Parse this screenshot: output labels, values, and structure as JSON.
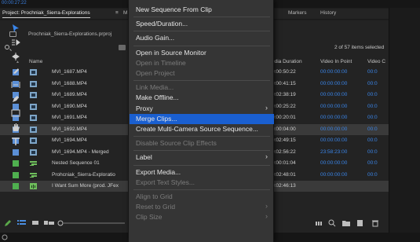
{
  "timecode": "00:00:27:22",
  "tabs": {
    "project": "Project: Prochniak_Sierra-Explorations",
    "project_menu": "≡",
    "m": "M",
    "markers": "Markers",
    "history": "History"
  },
  "project_file": "Prochniak_Sierra-Explorations.prproj",
  "selected_count": "2 of 57 items selected",
  "columns": {
    "name": "Name",
    "media_duration": "edia Duration",
    "video_in_point": "Video In Point",
    "video_c": "Video C"
  },
  "rows": [
    {
      "name": "MVI_1687.MP4",
      "duration": "0:00:50:22",
      "in": "00:00:00:00",
      "vc": "00:0",
      "swatch": "#5b8fd6",
      "icon": "clip"
    },
    {
      "name": "MVI_1688.MP4",
      "duration": "0:00:41:15",
      "in": "00:00:00:00",
      "vc": "00:0",
      "swatch": "#5b8fd6",
      "icon": "clip"
    },
    {
      "name": "MVI_1689.MP4",
      "duration": "0:02:38:19",
      "in": "00:00:00:00",
      "vc": "00:0",
      "swatch": "#5b8fd6",
      "icon": "clip"
    },
    {
      "name": "MVI_1690.MP4",
      "duration": "0:00:25:22",
      "in": "00:00:00:00",
      "vc": "00:0",
      "swatch": "#5b8fd6",
      "icon": "clip"
    },
    {
      "name": "MVI_1691.MP4",
      "duration": "0:00:20:01",
      "in": "00:00:00:00",
      "vc": "00:0",
      "swatch": "#5b8fd6",
      "icon": "clip"
    },
    {
      "name": "MVI_1692.MP4",
      "duration": "0:00:04:00",
      "in": "00:00:00:00",
      "vc": "00:0",
      "swatch": "#5b8fd6",
      "icon": "clip",
      "selected": true
    },
    {
      "name": "MVI_1694.MP4",
      "duration": "0:02:49:15",
      "in": "00:00:00:00",
      "vc": "00:0",
      "swatch": "#5b8fd6",
      "icon": "clip"
    },
    {
      "name": "MVI_1694.MP4 - Merged",
      "duration": "0:02:56:22",
      "in": "23:58:23:00",
      "vc": "00:0",
      "swatch": "#5b8fd6",
      "icon": "clip"
    },
    {
      "name": "Nested Sequence 01",
      "duration": "0:00:01:04",
      "in": "00:00:00:00",
      "vc": "00:0",
      "swatch": "#4fb04f",
      "icon": "sequence"
    },
    {
      "name": "Prohcniak_Sierra-Exploratio",
      "duration": "0:02:48:01",
      "in": "00:00:00:00",
      "vc": "00:0",
      "swatch": "#4fb04f",
      "icon": "sequence"
    },
    {
      "name": "I Want Sum More (prod. JFex",
      "duration": "0:02:46:13",
      "in": "",
      "vc": "",
      "swatch": "#4fb04f",
      "icon": "audio",
      "selected": true
    }
  ],
  "context_menu": {
    "items": [
      {
        "label": "New Sequence From Clip",
        "disabled": false
      },
      {
        "separator": true
      },
      {
        "label": "Speed/Duration...",
        "disabled": false
      },
      {
        "separator": true
      },
      {
        "label": "Audio Gain...",
        "disabled": false
      },
      {
        "separator": true
      },
      {
        "label": "Open in Source Monitor",
        "disabled": false
      },
      {
        "label": "Open in Timeline",
        "disabled": true
      },
      {
        "label": "Open Project",
        "disabled": true
      },
      {
        "separator": true
      },
      {
        "label": "Link Media...",
        "disabled": true
      },
      {
        "label": "Make Offline...",
        "disabled": false
      },
      {
        "label": "Proxy",
        "disabled": false,
        "submenu": true
      },
      {
        "label": "Merge Clips...",
        "disabled": false,
        "highlighted": true
      },
      {
        "label": "Create Multi-Camera Source Sequence...",
        "disabled": false
      },
      {
        "separator": true
      },
      {
        "label": "Disable Source Clip Effects",
        "disabled": true
      },
      {
        "separator": true
      },
      {
        "label": "Label",
        "disabled": false,
        "submenu": true
      },
      {
        "separator": true
      },
      {
        "label": "Export Media...",
        "disabled": false
      },
      {
        "label": "Export Text Styles...",
        "disabled": true
      },
      {
        "separator": true
      },
      {
        "label": "Align to Grid",
        "disabled": true
      },
      {
        "label": "Reset to Grid",
        "disabled": true,
        "submenu": true
      },
      {
        "label": "Clip Size",
        "disabled": true,
        "submenu": true
      }
    ]
  },
  "tools": [
    "selection-tool",
    "track-select-tool",
    "ripple-edit-tool",
    "razor-tool",
    "slip-tool",
    "pen-tool",
    "rectangle-tool",
    "hand-tool",
    "type-tool"
  ],
  "colors": {
    "highlight": "#1a5fd0",
    "timecode_blue": "#3a85e8",
    "menu_bg": "#353535",
    "panel_bg": "#232323"
  }
}
